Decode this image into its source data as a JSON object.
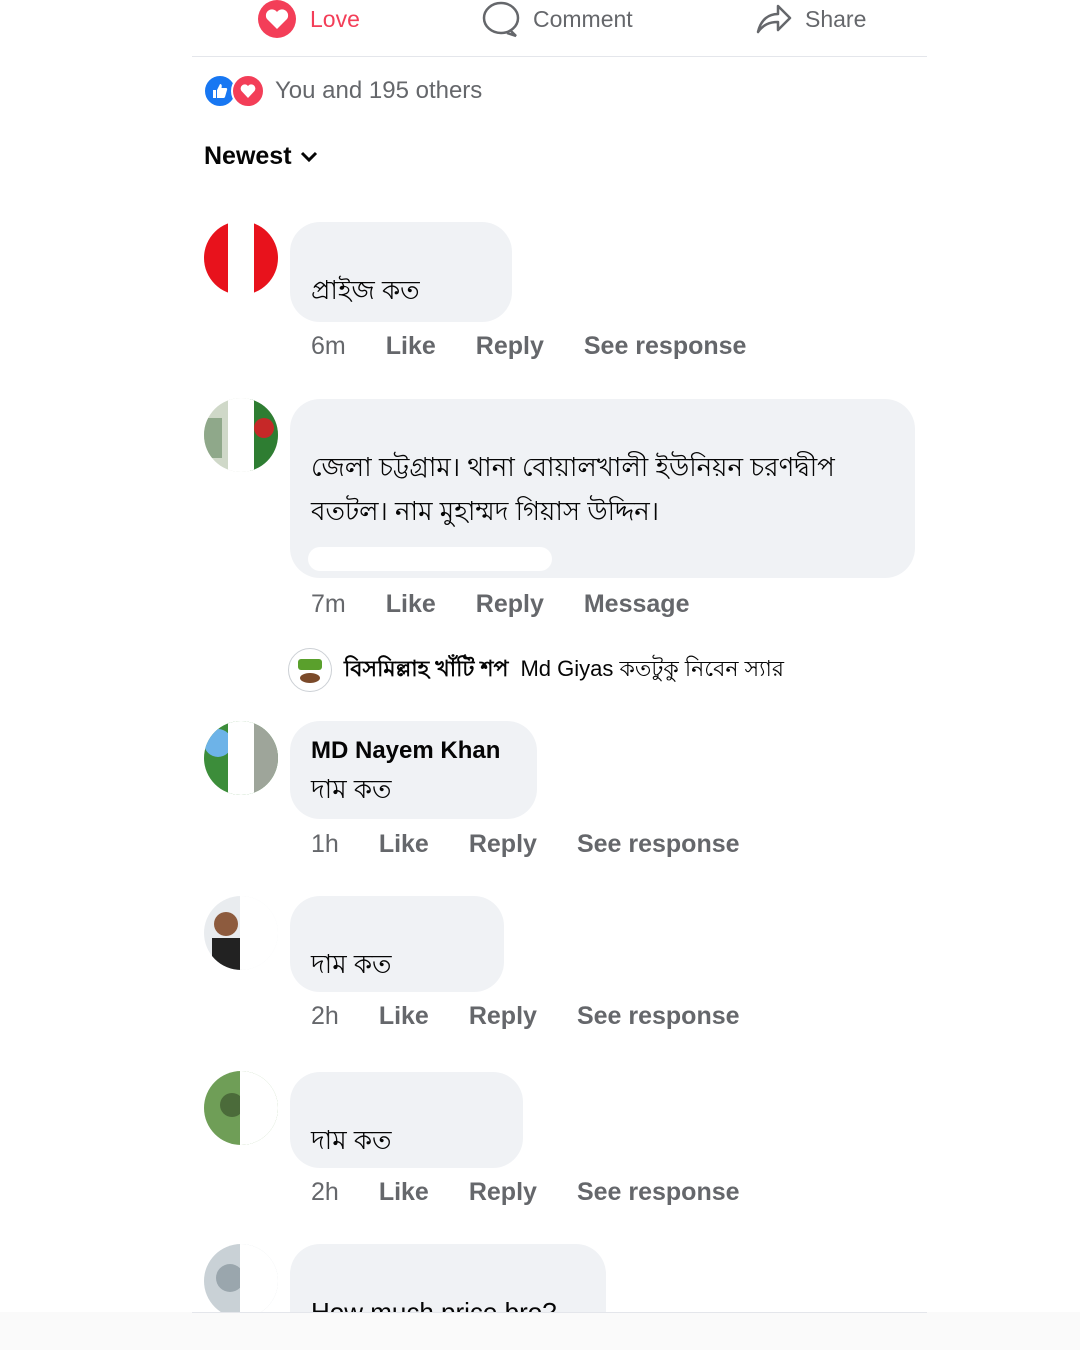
{
  "colors": {
    "love": "#f33e58",
    "like": "#1877f2",
    "muted": "#65676b",
    "bubble": "#f0f2f5"
  },
  "actions": {
    "love": "Love",
    "comment": "Comment",
    "share": "Share"
  },
  "reactions": {
    "text": "You and 195 others",
    "icons": [
      "like-icon",
      "love-icon"
    ]
  },
  "sort": {
    "label": "Newest"
  },
  "comments": [
    {
      "author": "",
      "text": "প্রাইজ কত",
      "time": "6m",
      "like": "Like",
      "reply": "Reply",
      "extra": "See response"
    },
    {
      "author": "",
      "text": "জেলা চট্টগ্রাম। থানা বোয়ালখালী ইউনিয়ন চরণদ্বীপ বতটল। নাম মুহাম্মদ গিয়াস উদ্দিন।",
      "time": "7m",
      "like": "Like",
      "reply": "Reply",
      "extra": "Message"
    },
    {
      "author": "MD Nayem Khan",
      "text": "দাম কত",
      "time": "1h",
      "like": "Like",
      "reply": "Reply",
      "extra": "See response"
    },
    {
      "author": "",
      "text": "দাম কত",
      "time": "2h",
      "like": "Like",
      "reply": "Reply",
      "extra": "See response"
    },
    {
      "author": "",
      "text": "দাম কত",
      "time": "2h",
      "like": "Like",
      "reply": "Reply",
      "extra": "See response"
    },
    {
      "author": "",
      "text": "How much price bro?"
    }
  ],
  "page_reply": {
    "name": "বিসমিল্লাহ খাঁটি শপ",
    "text": "Md Giyas কতটুকু নিবেন স্যার"
  }
}
